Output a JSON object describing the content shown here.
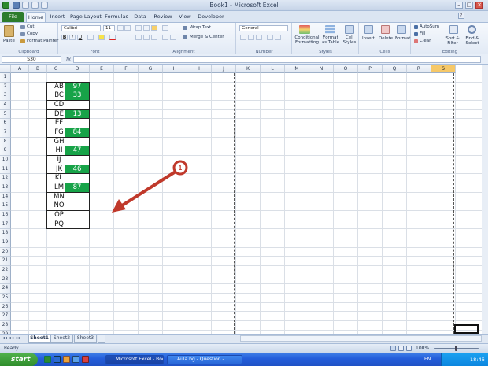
{
  "window": {
    "title": "Book1 - Microsoft Excel"
  },
  "ribbon_tabs": [
    "File",
    "Home",
    "Insert",
    "Page Layout",
    "Formulas",
    "Data",
    "Review",
    "View",
    "Developer"
  ],
  "ribbon": {
    "clipboard": {
      "paste": "Paste",
      "cut": "Cut",
      "copy": "Copy",
      "format_painter": "Format Painter",
      "label": "Clipboard"
    },
    "font": {
      "name": "Calibri",
      "size": "11",
      "label": "Font"
    },
    "alignment": {
      "wrap": "Wrap Text",
      "merge": "Merge & Center",
      "label": "Alignment"
    },
    "number": {
      "format": "General",
      "label": "Number"
    },
    "styles": {
      "conditional": "Conditional Formatting",
      "format_table": "Format as Table",
      "cell_styles": "Cell Styles",
      "label": "Styles"
    },
    "cells": {
      "insert": "Insert",
      "delete": "Delete",
      "format": "Format",
      "label": "Cells"
    },
    "editing": {
      "autosum": "AutoSum",
      "fill": "Fill",
      "clear": "Clear",
      "sort": "Sort & Filter",
      "find": "Find & Select",
      "label": "Editing"
    }
  },
  "formula_bar": {
    "name_box": "S30",
    "fx": "fx",
    "value": ""
  },
  "columns": [
    "A",
    "B",
    "C",
    "D",
    "E",
    "F",
    "G",
    "H",
    "I",
    "J",
    "K",
    "L",
    "M",
    "N",
    "O",
    "P",
    "Q",
    "R",
    "S"
  ],
  "rows": [
    "1",
    "2",
    "3",
    "4",
    "5",
    "6",
    "7",
    "8",
    "9",
    "10",
    "11",
    "12",
    "13",
    "14",
    "15",
    "16",
    "17",
    "18",
    "19",
    "20",
    "21",
    "22",
    "23",
    "24",
    "25",
    "26",
    "27",
    "28",
    "29",
    "30"
  ],
  "table": [
    {
      "code": "AB",
      "value": "97",
      "green": true
    },
    {
      "code": "BC",
      "value": "33",
      "green": true
    },
    {
      "code": "CD",
      "value": "",
      "green": false
    },
    {
      "code": "DE",
      "value": "13",
      "green": true
    },
    {
      "code": "EF",
      "value": "",
      "green": false
    },
    {
      "code": "FG",
      "value": "84",
      "green": true
    },
    {
      "code": "GH",
      "value": "",
      "green": false
    },
    {
      "code": "HI",
      "value": "47",
      "green": true
    },
    {
      "code": "IJ",
      "value": "",
      "green": false
    },
    {
      "code": "JK",
      "value": "46",
      "green": true
    },
    {
      "code": "KL",
      "value": "",
      "green": false
    },
    {
      "code": "LM",
      "value": "87",
      "green": true
    },
    {
      "code": "MN",
      "value": "",
      "green": false
    },
    {
      "code": "NO",
      "value": "",
      "green": false
    },
    {
      "code": "OP",
      "value": "",
      "green": false
    },
    {
      "code": "PQ",
      "value": "",
      "green": false
    }
  ],
  "annotation": {
    "number": "1",
    "color": "#c0392b"
  },
  "sheet_tabs": [
    "Sheet1",
    "Sheet2",
    "Sheet3"
  ],
  "status": {
    "ready": "Ready",
    "zoom": "100%"
  },
  "taskbar": {
    "start": "start",
    "items": [
      "Microsoft Excel - Book1",
      "Aula.bg - Question - ..."
    ],
    "lang": "EN",
    "clock": "18:46"
  },
  "colors": {
    "green": "#17a348",
    "selected_header": "#f6c868"
  }
}
